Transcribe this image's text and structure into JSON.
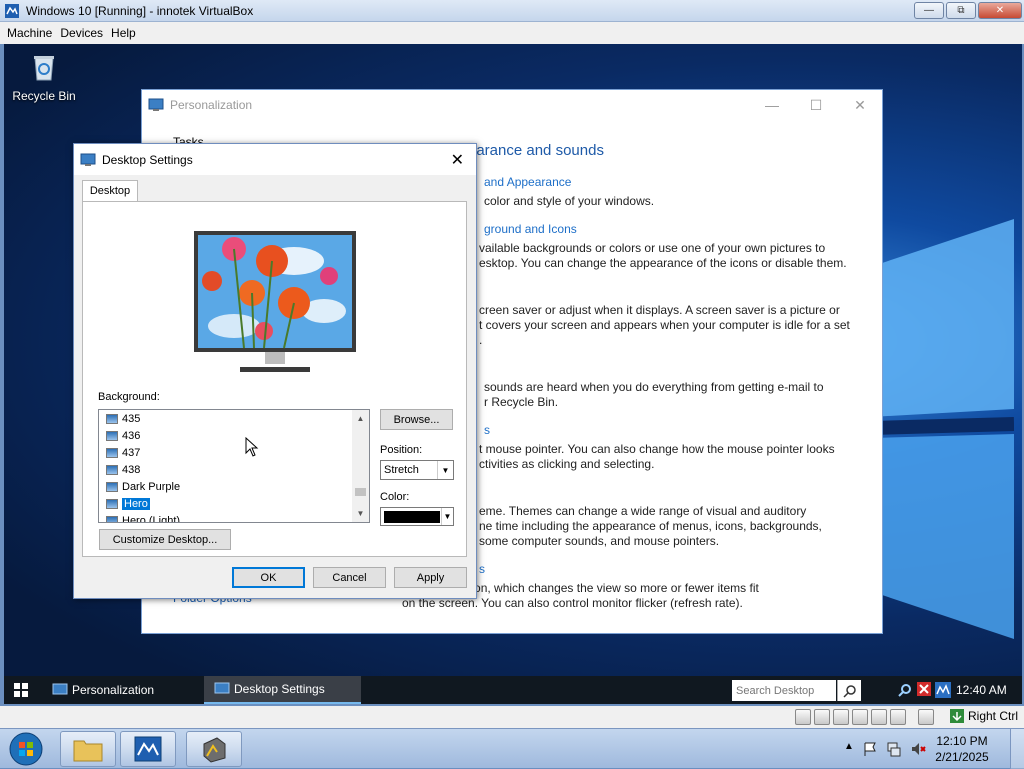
{
  "host": {
    "window_title": "Windows 10 [Running] - innotek VirtualBox",
    "menu": [
      "Machine",
      "Devices",
      "Help"
    ],
    "status": {
      "host_key": "Right Ctrl"
    },
    "clock": {
      "time": "12:10 PM",
      "date": "2/21/2025"
    }
  },
  "desktop": {
    "recycle_bin_label": "Recycle Bin"
  },
  "personalization": {
    "title": "Personalization",
    "tasks_label": "Tasks",
    "folder_options_link": "Folder Options",
    "heading": "earance and sounds",
    "sections": [
      {
        "title": "and Appearance",
        "text": "color and style of your windows."
      },
      {
        "title": "ground and Icons",
        "text": "vailable backgrounds or colors or use one of your own pictures to\nesktop. You can change the appearance of the icons or disable them."
      },
      {
        "title": "",
        "text": "creen saver or adjust when it displays. A screen saver is a picture or\nt covers your screen and appears when your computer is idle for a set\n."
      },
      {
        "title": "",
        "text": "sounds are heard when you do everything from getting e-mail to\nr Recycle Bin."
      },
      {
        "title": "s",
        "text": "t mouse pointer. You can also change how the mouse pointer looks\nctivities as clicking and selecting."
      },
      {
        "title": "",
        "text": "eme. Themes can change a wide range of visual and auditory\nne time including the appearance of menus, icons, backgrounds,\nsome computer sounds, and mouse pointers."
      },
      {
        "title": "s",
        "text": "onitor resolution, which changes the view so more or fewer items fit\non the screen. You can also control monitor flicker (refresh rate)."
      }
    ]
  },
  "desktop_settings": {
    "title": "Desktop Settings",
    "tab": "Desktop",
    "background_label": "Background:",
    "backgrounds": [
      "435",
      "436",
      "437",
      "438",
      "Dark Purple",
      "Hero",
      "Hero (Light)"
    ],
    "selected_background": "Hero",
    "browse_button": "Browse...",
    "position_label": "Position:",
    "position_value": "Stretch",
    "color_label": "Color:",
    "color_value": "#000000",
    "customize_button": "Customize Desktop...",
    "ok_button": "OK",
    "cancel_button": "Cancel",
    "apply_button": "Apply"
  },
  "guest_taskbar": {
    "items": [
      "Personalization",
      "Desktop Settings"
    ],
    "active_item": "Desktop Settings",
    "search_placeholder": "Search Desktop",
    "clock": "12:40 AM"
  },
  "colors": {
    "accent": "#0078d7",
    "link": "#1e6fc8",
    "guest_taskbar": "#101820"
  }
}
